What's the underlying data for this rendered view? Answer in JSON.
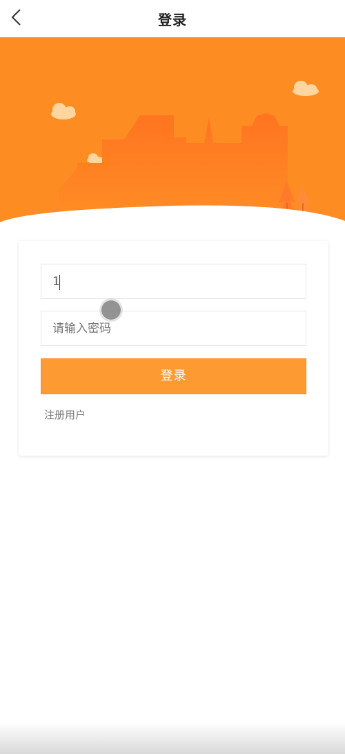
{
  "header": {
    "title": "登录",
    "back_icon": "chevron-left-icon"
  },
  "hero": {
    "background_color": "#fd8c22",
    "building_color": "#ff7a1f"
  },
  "login_form": {
    "account_value": "1",
    "password_placeholder": "请输入密码",
    "login_button_label": "登录",
    "register_link_label": "注册用户"
  },
  "colors": {
    "accent": "#fd9a32",
    "text_secondary": "#777777"
  }
}
